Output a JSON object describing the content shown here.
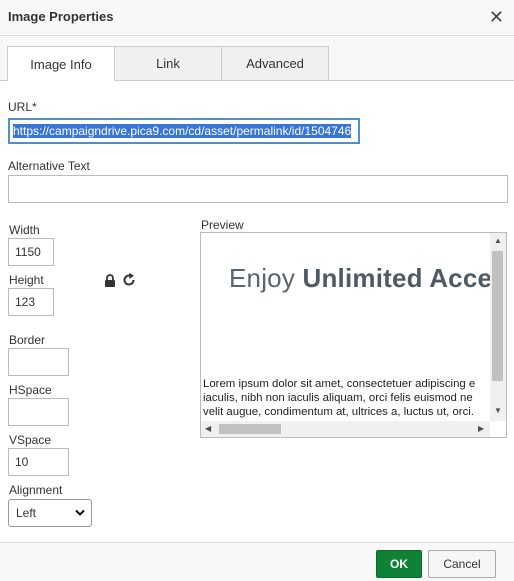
{
  "dialog": {
    "title": "Image Properties",
    "close_glyph": "✕"
  },
  "tabs": [
    {
      "label": "Image Info",
      "active": true
    },
    {
      "label": "Link",
      "active": false
    },
    {
      "label": "Advanced",
      "active": false
    }
  ],
  "url": {
    "label": "URL*",
    "value": "https://campaigndrive.pica9.com/cd/asset/permalink/id/1504746"
  },
  "alt": {
    "label": "Alternative Text",
    "value": ""
  },
  "width": {
    "label": "Width",
    "value": "1150"
  },
  "height": {
    "label": "Height",
    "value": "123"
  },
  "border": {
    "label": "Border",
    "value": ""
  },
  "hspace": {
    "label": "HSpace",
    "value": ""
  },
  "vspace": {
    "label": "VSpace",
    "value": "10"
  },
  "alignment": {
    "label": "Alignment",
    "value": "Left"
  },
  "preview": {
    "label": "Preview",
    "banner_light": "Enjoy",
    "banner_bold": "Unlimited Access",
    "lines": [
      "Lorem ipsum dolor sit amet, consectetuer adipiscing e",
      "iaculis, nibh non iaculis aliquam, orci felis euismod ne",
      "velit augue, condimentum at, ultrices a, luctus ut, orci."
    ]
  },
  "footer": {
    "ok_label": "OK",
    "cancel_label": "Cancel"
  },
  "icons": {
    "lock": "lock-icon",
    "reset": "reset-size-icon",
    "close": "close-icon"
  },
  "colors": {
    "ok_button": "#108238",
    "url_focus": "#4a90d9",
    "selection": "#3875d7"
  }
}
